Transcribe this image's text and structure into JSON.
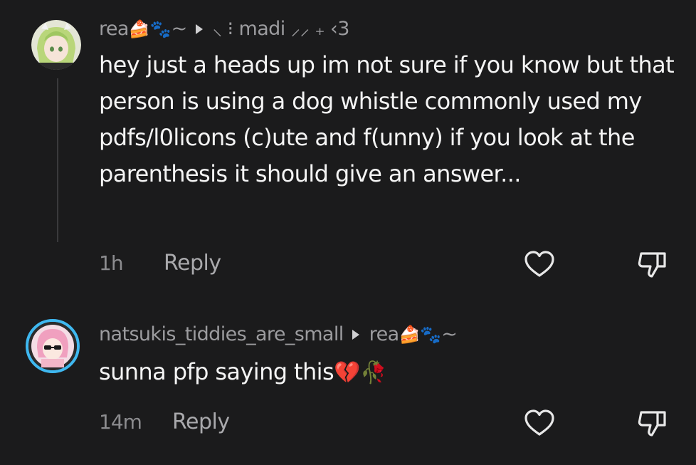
{
  "comments": [
    {
      "author": "rea",
      "author_emoji": "🍰🐾",
      "author_suffix": "~",
      "reply_to": "⸜ ⁝ madi ⸝⸝ ₊ ‹3",
      "text": "hey just a heads up im not sure if you know but that person is using a dog whistle commonly used my pdfs/l0licons (c)ute and f(unny) if you look at the parenthesis it should give an answer...",
      "time": "1h",
      "reply_label": "Reply",
      "icons": [
        "heart-icon",
        "dislike-icon"
      ],
      "avatar_color": "#d8dcc8"
    },
    {
      "author": "natsukis_tiddies_are_small",
      "reply_to": "rea",
      "reply_to_emoji": "🍰🐾",
      "reply_to_suffix": "~",
      "text": "sunna pfp saying this",
      "text_emoji": "💔🥀",
      "time": "14m",
      "reply_label": "Reply",
      "icons": [
        "heart-icon",
        "dislike-icon"
      ],
      "avatar_ring_color": "#3fb8f0",
      "avatar_color": "#f0a6c0"
    }
  ]
}
